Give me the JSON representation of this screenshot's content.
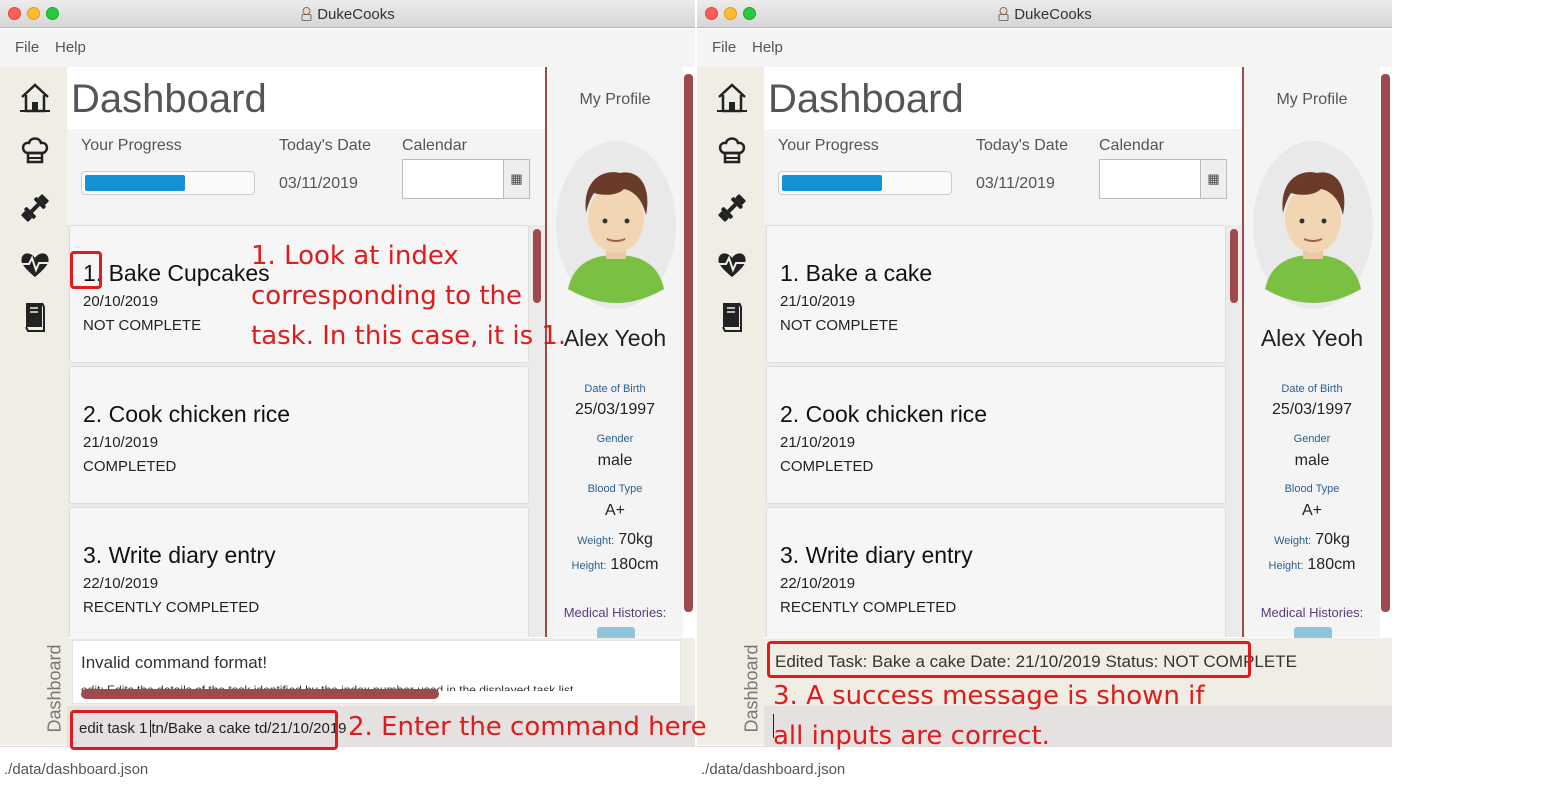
{
  "app_title": "DukeCooks",
  "menu": {
    "file": "File",
    "help": "Help"
  },
  "sidebar_vertical_label": "Dashboard",
  "sidebar_icons": [
    "home-icon",
    "chef-hat-icon",
    "dumbbell-icon",
    "heartbeat-icon",
    "diary-book-icon"
  ],
  "dashboard": {
    "title": "Dashboard",
    "progress_label": "Your Progress",
    "progress_value": 0.6,
    "date_label": "Today's Date",
    "date_value": "03/11/2019",
    "calendar_label": "Calendar",
    "calendar_button": "▦"
  },
  "profile": {
    "title": "My Profile",
    "name": "Alex Yeoh",
    "dob_label": "Date of Birth",
    "dob": "25/03/1997",
    "gender_label": "Gender",
    "gender": "male",
    "blood_label": "Blood Type",
    "blood": "A+",
    "weight_label": "Weight:",
    "weight": "70kg",
    "height_label": "Height:",
    "height": "180cm",
    "medical_label": "Medical Histories:"
  },
  "left": {
    "tasks": [
      {
        "index": "1.",
        "name": "Bake Cupcakes",
        "date": "20/10/2019",
        "status": "NOT COMPLETE"
      },
      {
        "index": "2.",
        "name": "Cook chicken rice",
        "date": "21/10/2019",
        "status": "COMPLETED"
      },
      {
        "index": "3.",
        "name": "Write diary entry",
        "date": "22/10/2019",
        "status": "RECENTLY COMPLETED"
      }
    ],
    "result_text": "Invalid command format!",
    "result_text_2": "edit: Edits the details of the task identified by the index number used in the displayed task list.",
    "command_before_cursor": "edit task 1",
    "command_after_cursor": "tn/Bake a cake td/21/10/2019",
    "footer": "./data/dashboard.json"
  },
  "right": {
    "tasks": [
      {
        "index": "1.",
        "name": "Bake a cake",
        "date": "21/10/2019",
        "status": "NOT COMPLETE"
      },
      {
        "index": "2.",
        "name": "Cook chicken rice",
        "date": "21/10/2019",
        "status": "COMPLETED"
      },
      {
        "index": "3.",
        "name": "Write diary entry",
        "date": "22/10/2019",
        "status": "RECENTLY COMPLETED"
      }
    ],
    "result_text": "Edited Task: Bake a cake Date: 21/10/2019 Status: NOT COMPLETE",
    "command": "",
    "footer": "./data/dashboard.json"
  },
  "annotations": {
    "step1_line1": "1. Look at index",
    "step1_line2": "corresponding to the",
    "step1_line3": "task. In this case, it is 1.",
    "step2": "2. Enter the command here",
    "step3_line1": "3. A success message is shown if",
    "step3_line2": "all inputs are correct."
  },
  "colors": {
    "accent": "#9e4a4d",
    "progress": "#1690d6",
    "annotation": "#e01b1b"
  }
}
